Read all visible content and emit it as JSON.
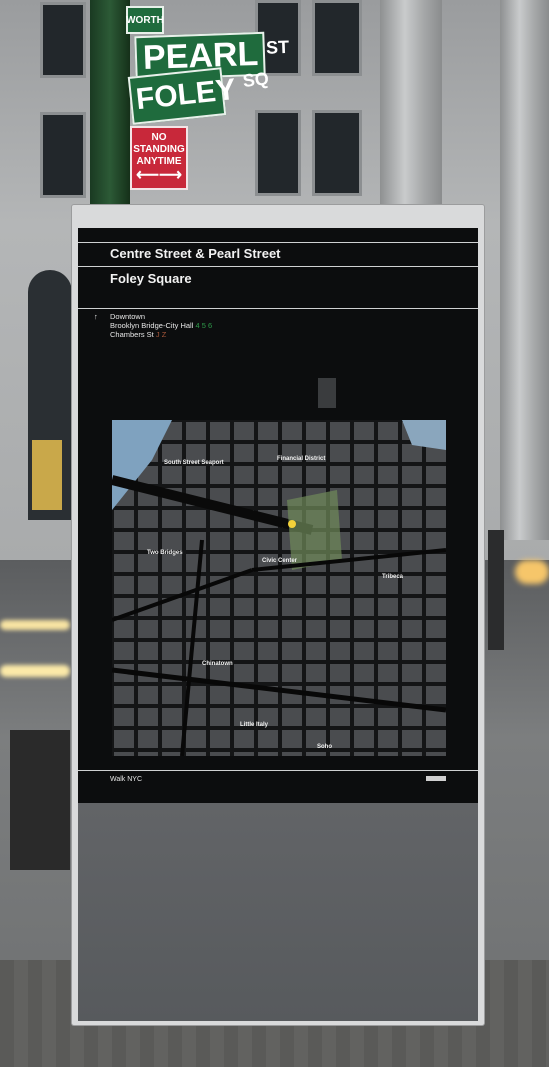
{
  "street_signs": {
    "top": "WORTH",
    "pearl": "PEARL",
    "pearl_suffix": "ST",
    "foley": "FOLEY",
    "foley_suffix": "SQ",
    "no_standing_line1": "NO STANDING",
    "no_standing_line2": "ANYTIME",
    "no_standing_arrow": "⟵⟶"
  },
  "kiosk": {
    "title": "Centre Street & Pearl Street",
    "subtitle": "Foley Square",
    "direction_arrow": "↑",
    "direction": "Downtown",
    "stations": [
      "Brooklyn Bridge-City Hall",
      "Chambers St"
    ],
    "station_lines": [
      "4 5 6",
      "J Z"
    ],
    "footer_brand": "Walk NYC",
    "map_labels": [
      "South Street Seaport",
      "Financial District",
      "Two Bridges",
      "Civic Center",
      "Tribeca",
      "Chinatown",
      "Little Italy",
      "Soho"
    ]
  },
  "colors": {
    "sign_green": "#1f6b3d",
    "sign_red": "#c8283a",
    "panel": "#0c0d0e",
    "line_green": "#2e9a4a",
    "line_brown": "#a8573a"
  }
}
